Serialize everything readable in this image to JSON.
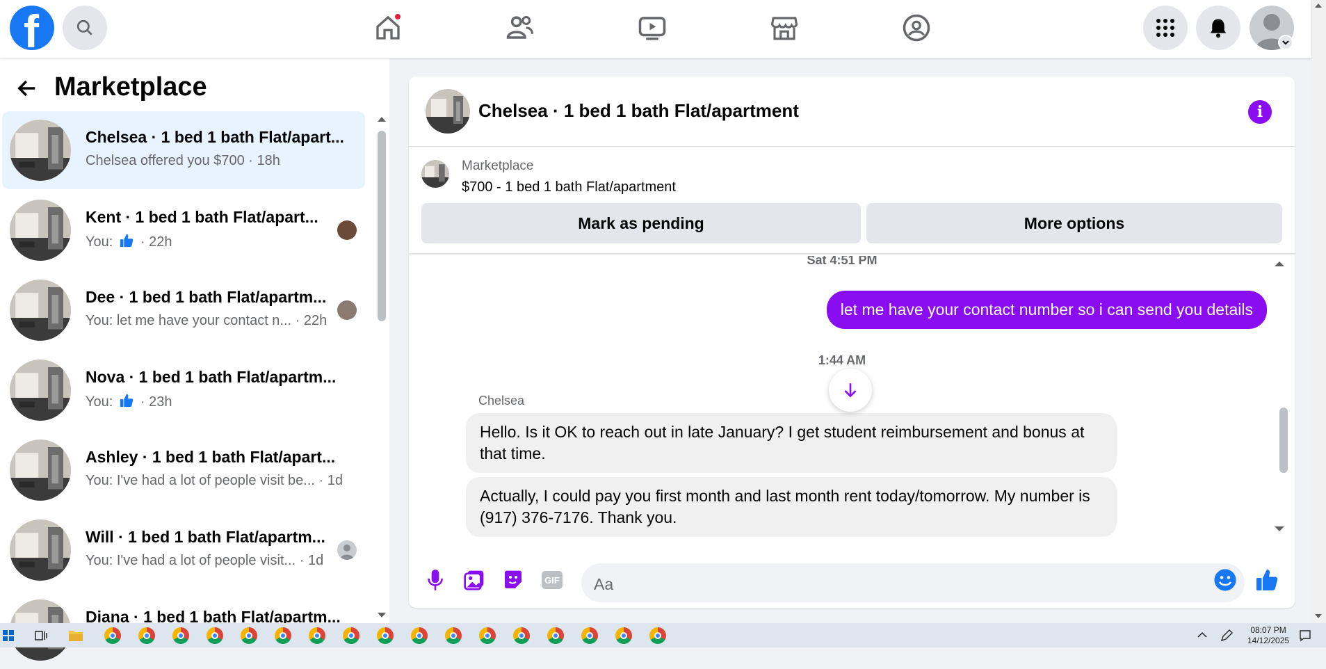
{
  "header": {
    "logo": "f",
    "nav": [
      "home-icon",
      "friends-icon",
      "watch-icon",
      "marketplace-icon",
      "groups-icon"
    ]
  },
  "sidebar": {
    "title": "Marketplace",
    "conversations": [
      {
        "title": "Chelsea · 1 bed 1 bath Flat/apart...",
        "sub": "Chelsea offered you $700",
        "time": "18h",
        "active": true
      },
      {
        "title": "Kent · 1 bed 1 bath Flat/apart...",
        "sub": "You:",
        "time": "22h",
        "like": true
      },
      {
        "title": "Dee · 1 bed 1 bath Flat/apartm...",
        "sub": "You: let me have your contact n...",
        "time": "22h"
      },
      {
        "title": "Nova · 1 bed 1 bath Flat/apartm...",
        "sub": "You:",
        "time": "23h",
        "like": true
      },
      {
        "title": "Ashley · 1 bed 1 bath Flat/apart...",
        "sub": "You: I've had a lot of people visit be...",
        "time": "1d"
      },
      {
        "title": "Will · 1 bed 1 bath Flat/apartm...",
        "sub": "You: I've had a lot of people visit...",
        "time": "1d"
      },
      {
        "title": "Diana · 1 bed 1 bath Flat/apartm...",
        "sub": "",
        "time": ""
      }
    ]
  },
  "chat": {
    "title": "Chelsea · 1 bed 1 bath Flat/apartment",
    "marketplace_label": "Marketplace",
    "listing": "$700 - 1 bed 1 bath Flat/apartment",
    "mark_pending": "Mark as pending",
    "more_options": "More options",
    "timestamp1": "Sat 4:51 PM",
    "outgoing": "let me have your contact number so i can send you details",
    "timestamp2": "1:44 AM",
    "sender": "Chelsea",
    "incoming1": "Hello. Is it OK to reach out in late January? I get student reimbursement and bonus at that time.",
    "incoming2": "Actually, I could pay you first month and last month rent today/tomorrow. My number is (917) 376-7176. Thank you.",
    "input_placeholder": "Aa"
  },
  "taskbar": {
    "time": "08:07 PM",
    "date": "14/12/2025"
  },
  "colors": {
    "brand": "#1877f2",
    "accent": "#8a0cf0"
  }
}
